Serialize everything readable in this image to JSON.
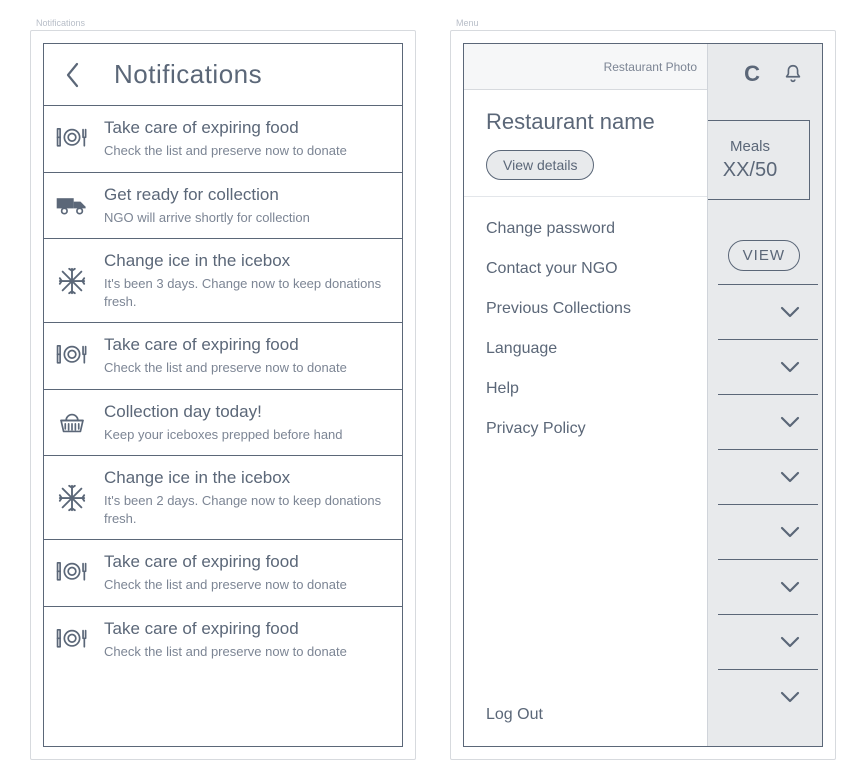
{
  "frames": {
    "notifications_label": "Notifications",
    "menu_label": "Menu"
  },
  "notifications": {
    "title": "Notifications",
    "items": [
      {
        "icon": "plate",
        "title": "Take care of expiring food",
        "body": "Check the list and preserve now to donate"
      },
      {
        "icon": "truck",
        "title": "Get ready for collection",
        "body": "NGO will arrive shortly for collection"
      },
      {
        "icon": "snow",
        "title": "Change ice in the icebox",
        "body": "It's been 3 days. Change now to keep donations fresh."
      },
      {
        "icon": "plate",
        "title": "Take care of expiring food",
        "body": "Check the list and preserve now to donate"
      },
      {
        "icon": "basket",
        "title": "Collection day today!",
        "body": "Keep your iceboxes prepped before hand"
      },
      {
        "icon": "snow",
        "title": "Change ice in the icebox",
        "body": "It's been 2 days. Change now to keep donations fresh."
      },
      {
        "icon": "plate",
        "title": "Take care of expiring food",
        "body": "Check the list and preserve now to donate"
      },
      {
        "icon": "plate",
        "title": "Take care of expiring food",
        "body": "Check the list and preserve now to donate"
      }
    ]
  },
  "menu": {
    "photo_label": "Restaurant Photo",
    "restaurant_name": "Restaurant name",
    "view_details_label": "View details",
    "links": [
      "Change password",
      "Contact your NGO",
      "Previous Collections",
      "Language",
      "Help",
      "Privacy Policy"
    ],
    "logout_label": "Log Out"
  },
  "behind": {
    "logo_letter": "C",
    "meals_label": "Meals",
    "meals_value": "XX/50",
    "view_label": "VIEW",
    "row_count": 8
  }
}
